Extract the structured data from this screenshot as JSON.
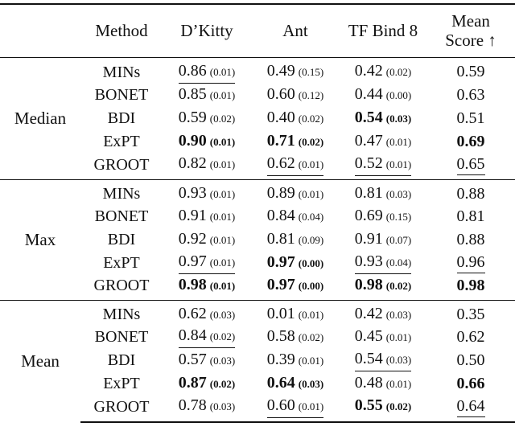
{
  "table": {
    "headers": [
      "",
      "Method",
      "D’Kitty",
      "Ant",
      "TF Bind 8",
      "Mean Score ↑"
    ],
    "header_mean_line1": "Mean",
    "header_mean_line2": "Score ↑",
    "groups": [
      {
        "name": "Median",
        "rows": [
          {
            "method": "MINs",
            "dkitty": {
              "v": "0.86",
              "sd": "(0.01)",
              "style": "underline"
            },
            "ant": {
              "v": "0.49",
              "sd": "(0.15)",
              "style": ""
            },
            "tfbind8": {
              "v": "0.42",
              "sd": "(0.02)",
              "style": ""
            },
            "mean": {
              "v": "0.59",
              "style": ""
            }
          },
          {
            "method": "BONET",
            "dkitty": {
              "v": "0.85",
              "sd": "(0.01)",
              "style": ""
            },
            "ant": {
              "v": "0.60",
              "sd": "(0.12)",
              "style": ""
            },
            "tfbind8": {
              "v": "0.44",
              "sd": "(0.00)",
              "style": ""
            },
            "mean": {
              "v": "0.63",
              "style": ""
            }
          },
          {
            "method": "BDI",
            "dkitty": {
              "v": "0.59",
              "sd": "(0.02)",
              "style": ""
            },
            "ant": {
              "v": "0.40",
              "sd": "(0.02)",
              "style": ""
            },
            "tfbind8": {
              "v": "0.54",
              "sd": "(0.03)",
              "style": "bold"
            },
            "mean": {
              "v": "0.51",
              "style": ""
            }
          },
          {
            "method": "ExPT",
            "dkitty": {
              "v": "0.90",
              "sd": "(0.01)",
              "style": "bold"
            },
            "ant": {
              "v": "0.71",
              "sd": "(0.02)",
              "style": "bold"
            },
            "tfbind8": {
              "v": "0.47",
              "sd": "(0.01)",
              "style": ""
            },
            "mean": {
              "v": "0.69",
              "style": "bold"
            }
          },
          {
            "method": "GROOT",
            "dkitty": {
              "v": "0.82",
              "sd": "(0.01)",
              "style": ""
            },
            "ant": {
              "v": "0.62",
              "sd": "(0.01)",
              "style": "underline"
            },
            "tfbind8": {
              "v": "0.52",
              "sd": "(0.01)",
              "style": "underline"
            },
            "mean": {
              "v": "0.65",
              "style": "underline"
            }
          }
        ]
      },
      {
        "name": "Max",
        "rows": [
          {
            "method": "MINs",
            "dkitty": {
              "v": "0.93",
              "sd": "(0.01)",
              "style": ""
            },
            "ant": {
              "v": "0.89",
              "sd": "(0.01)",
              "style": ""
            },
            "tfbind8": {
              "v": "0.81",
              "sd": "(0.03)",
              "style": ""
            },
            "mean": {
              "v": "0.88",
              "style": ""
            }
          },
          {
            "method": "BONET",
            "dkitty": {
              "v": "0.91",
              "sd": "(0.01)",
              "style": ""
            },
            "ant": {
              "v": "0.84",
              "sd": "(0.04)",
              "style": ""
            },
            "tfbind8": {
              "v": "0.69",
              "sd": "(0.15)",
              "style": ""
            },
            "mean": {
              "v": "0.81",
              "style": ""
            }
          },
          {
            "method": "BDI",
            "dkitty": {
              "v": "0.92",
              "sd": "(0.01)",
              "style": ""
            },
            "ant": {
              "v": "0.81",
              "sd": "(0.09)",
              "style": ""
            },
            "tfbind8": {
              "v": "0.91",
              "sd": "(0.07)",
              "style": ""
            },
            "mean": {
              "v": "0.88",
              "style": ""
            }
          },
          {
            "method": "ExPT",
            "dkitty": {
              "v": "0.97",
              "sd": "(0.01)",
              "style": "underline"
            },
            "ant": {
              "v": "0.97",
              "sd": "(0.00)",
              "style": "bold"
            },
            "tfbind8": {
              "v": "0.93",
              "sd": "(0.04)",
              "style": "underline"
            },
            "mean": {
              "v": "0.96",
              "style": "underline"
            }
          },
          {
            "method": "GROOT",
            "dkitty": {
              "v": "0.98",
              "sd": "(0.01)",
              "style": "bold"
            },
            "ant": {
              "v": "0.97",
              "sd": "(0.00)",
              "style": "bold"
            },
            "tfbind8": {
              "v": "0.98",
              "sd": "(0.02)",
              "style": "bold"
            },
            "mean": {
              "v": "0.98",
              "style": "bold"
            }
          }
        ]
      },
      {
        "name": "Mean",
        "rows": [
          {
            "method": "MINs",
            "dkitty": {
              "v": "0.62",
              "sd": "(0.03)",
              "style": ""
            },
            "ant": {
              "v": "0.01",
              "sd": "(0.01)",
              "style": ""
            },
            "tfbind8": {
              "v": "0.42",
              "sd": "(0.03)",
              "style": ""
            },
            "mean": {
              "v": "0.35",
              "style": ""
            }
          },
          {
            "method": "BONET",
            "dkitty": {
              "v": "0.84",
              "sd": "(0.02)",
              "style": "underline"
            },
            "ant": {
              "v": "0.58",
              "sd": "(0.02)",
              "style": ""
            },
            "tfbind8": {
              "v": "0.45",
              "sd": "(0.01)",
              "style": ""
            },
            "mean": {
              "v": "0.62",
              "style": ""
            }
          },
          {
            "method": "BDI",
            "dkitty": {
              "v": "0.57",
              "sd": "(0.03)",
              "style": ""
            },
            "ant": {
              "v": "0.39",
              "sd": "(0.01)",
              "style": ""
            },
            "tfbind8": {
              "v": "0.54",
              "sd": "(0.03)",
              "style": "underline"
            },
            "mean": {
              "v": "0.50",
              "style": ""
            }
          },
          {
            "method": "ExPT",
            "dkitty": {
              "v": "0.87",
              "sd": "(0.02)",
              "style": "bold"
            },
            "ant": {
              "v": "0.64",
              "sd": "(0.03)",
              "style": "bold"
            },
            "tfbind8": {
              "v": "0.48",
              "sd": "(0.01)",
              "style": ""
            },
            "mean": {
              "v": "0.66",
              "style": "bold"
            }
          },
          {
            "method": "GROOT",
            "dkitty": {
              "v": "0.78",
              "sd": "(0.03)",
              "style": ""
            },
            "ant": {
              "v": "0.60",
              "sd": "(0.01)",
              "style": "underline"
            },
            "tfbind8": {
              "v": "0.55",
              "sd": "(0.02)",
              "style": "bold"
            },
            "mean": {
              "v": "0.64",
              "style": "underline"
            }
          }
        ]
      }
    ]
  }
}
